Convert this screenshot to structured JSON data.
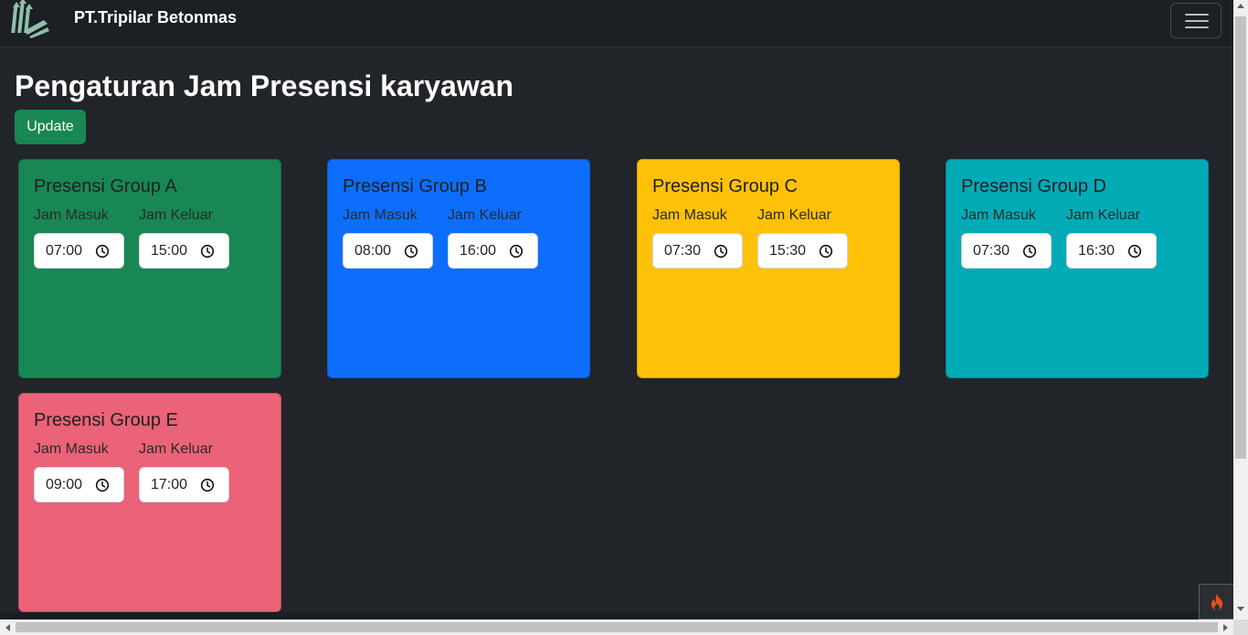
{
  "navbar": {
    "brand_name": "PT.Tripilar Betonmas",
    "logo_icon": "tripilar-logo-icon",
    "menu_icon": "hamburger-menu-icon"
  },
  "page": {
    "title": "Pengaturan Jam Presensi karyawan",
    "update_label": "Update"
  },
  "labels": {
    "masuk": "Jam Masuk",
    "keluar": "Jam Keluar"
  },
  "groups": [
    {
      "title": "Presensi Group A",
      "color": "#198754",
      "masuk": "07:00",
      "keluar": "15:00"
    },
    {
      "title": "Presensi Group B",
      "color": "#0d6efd",
      "masuk": "08:00",
      "keluar": "16:00"
    },
    {
      "title": "Presensi Group C",
      "color": "#ffc107",
      "masuk": "07:30",
      "keluar": "15:30"
    },
    {
      "title": "Presensi Group D",
      "color": "#00abb6",
      "masuk": "07:30",
      "keluar": "16:30"
    },
    {
      "title": "Presensi Group E",
      "color": "#ea6378",
      "masuk": "09:00",
      "keluar": "17:00"
    }
  ],
  "debug_toolbar": {
    "icon": "flame-icon"
  },
  "colors": {
    "background": "#212529",
    "navbar": "#1c1f23",
    "update_button": "#198754"
  }
}
